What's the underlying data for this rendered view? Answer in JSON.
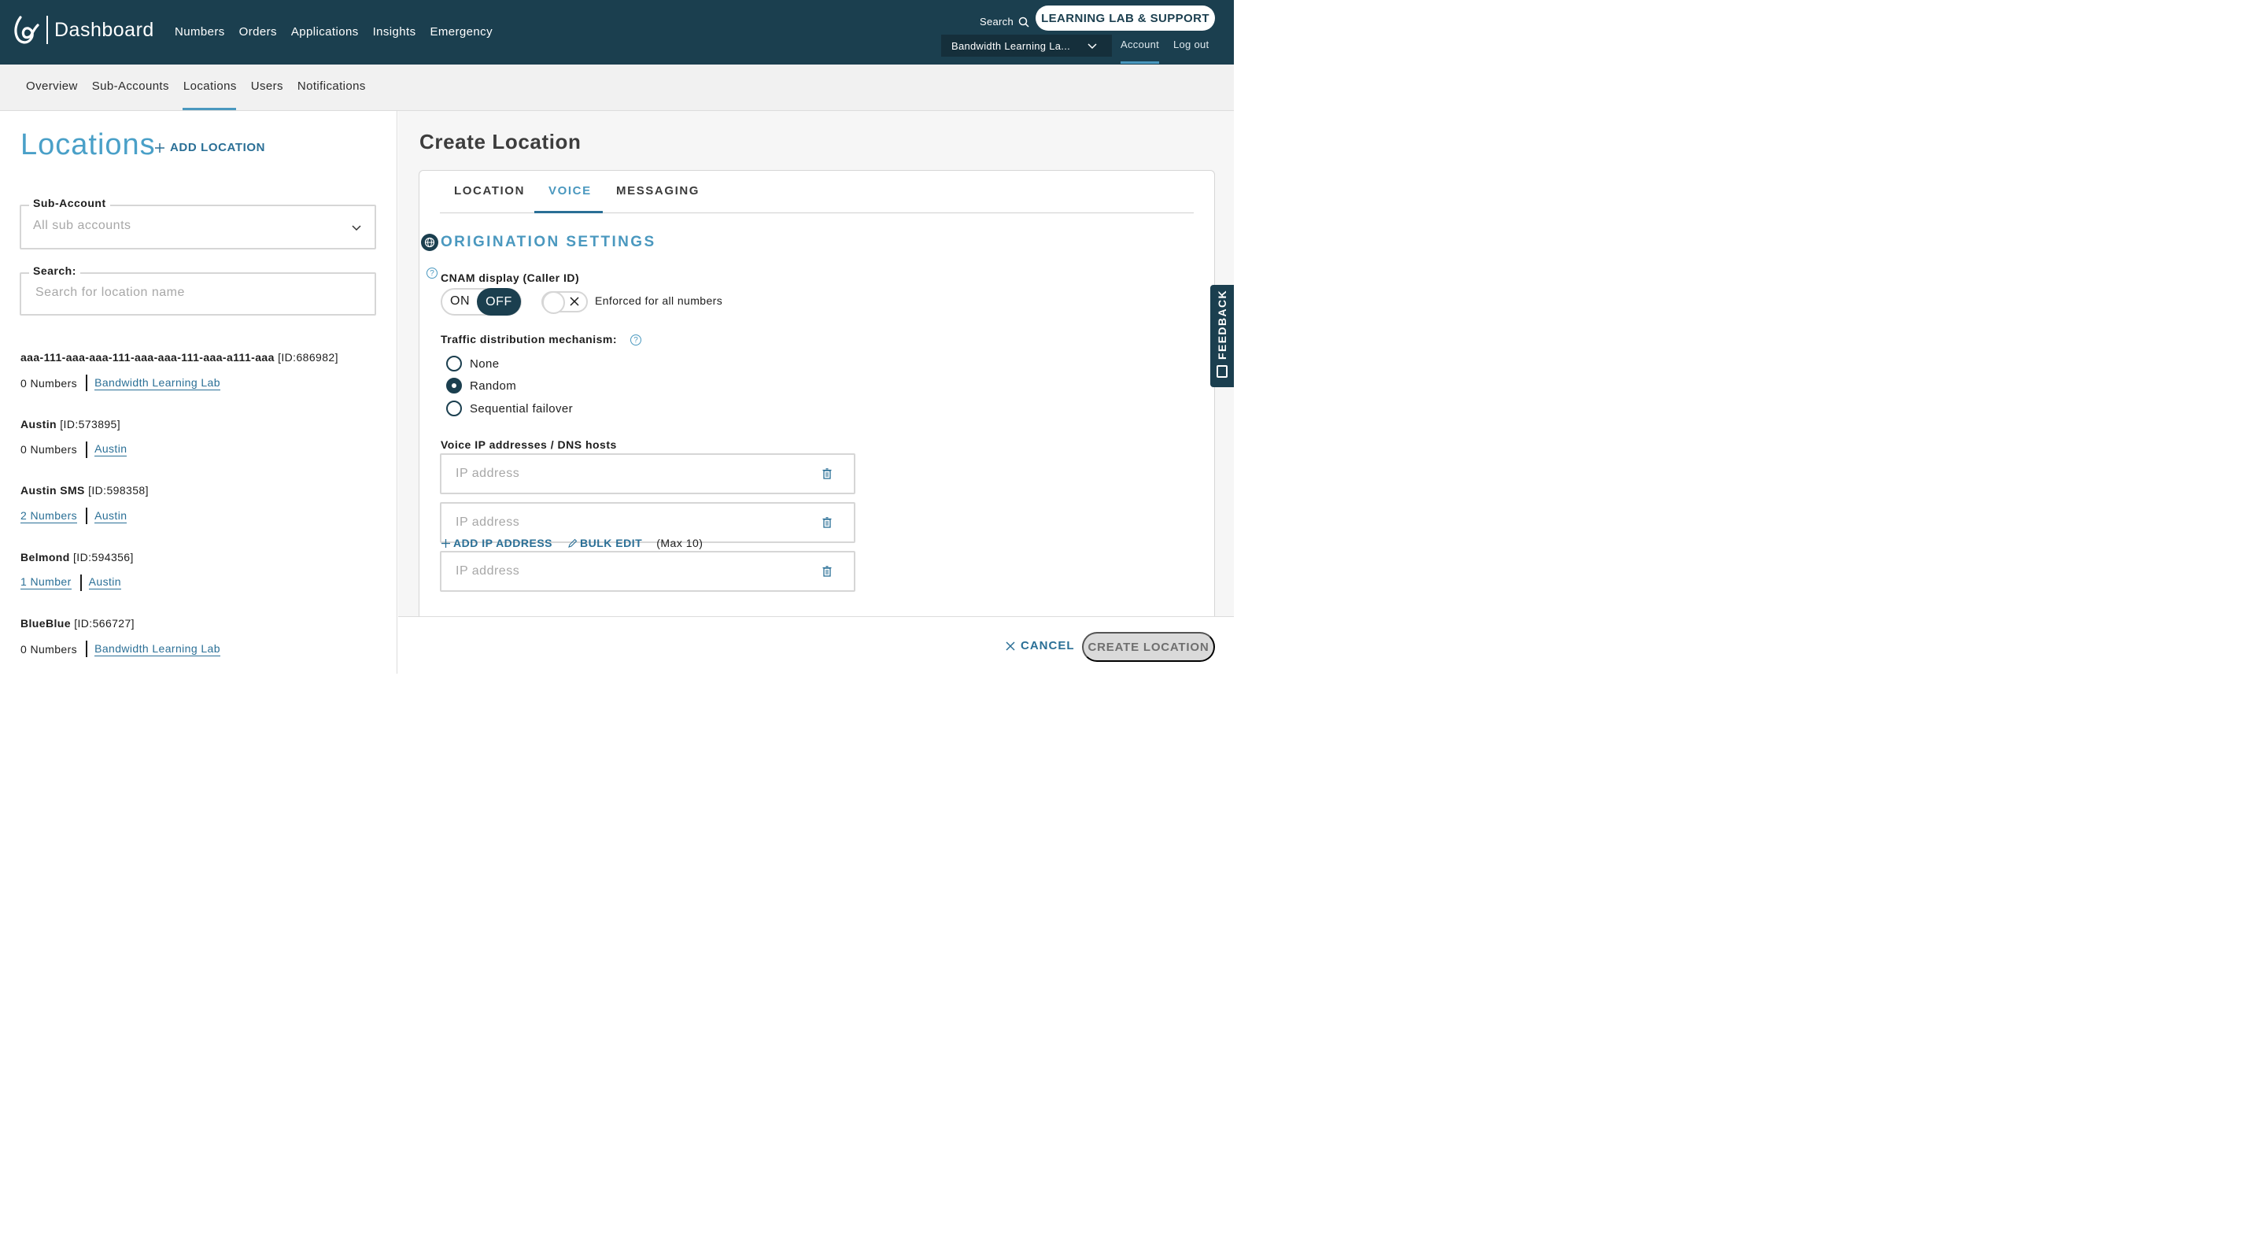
{
  "header": {
    "brand": "Dashboard",
    "nav": [
      "Numbers",
      "Orders",
      "Applications",
      "Insights",
      "Emergency"
    ],
    "search_label": "Search",
    "support_button": "LEARNING LAB & SUPPORT",
    "account_selector": "Bandwidth Learning La...",
    "account_link": "Account",
    "logout_link": "Log out",
    "colors": {
      "bar": "#1b3f4f",
      "accent": "#4a98bf"
    }
  },
  "subnav": {
    "items": [
      "Overview",
      "Sub-Accounts",
      "Locations",
      "Users",
      "Notifications"
    ],
    "active": "Locations"
  },
  "locations_panel": {
    "title": "Locations",
    "add_label": "ADD LOCATION",
    "subaccount": {
      "label": "Sub-Account",
      "value": "All sub accounts"
    },
    "search": {
      "label": "Search:",
      "placeholder": "Search for location name"
    },
    "items": [
      {
        "name": "aaa-111-aaa-aaa-111-aaa-aaa-111-aaa-a111-aaa",
        "id": "[ID:686982]",
        "numbers": "0 Numbers",
        "numbers_link": false,
        "subaccount": "Bandwidth Learning Lab"
      },
      {
        "name": "Austin",
        "id": "[ID:573895]",
        "numbers": "0 Numbers",
        "numbers_link": false,
        "subaccount": "Austin"
      },
      {
        "name": "Austin SMS",
        "id": "[ID:598358]",
        "numbers": "2 Numbers",
        "numbers_link": true,
        "subaccount": "Austin"
      },
      {
        "name": "Belmond",
        "id": "[ID:594356]",
        "numbers": "1 Number",
        "numbers_link": true,
        "subaccount": "Austin"
      },
      {
        "name": "BlueBlue",
        "id": "[ID:566727]",
        "numbers": "0 Numbers",
        "numbers_link": false,
        "subaccount": "Bandwidth Learning Lab"
      }
    ]
  },
  "create_location": {
    "title": "Create Location",
    "tabs": [
      "LOCATION",
      "VOICE",
      "MESSAGING"
    ],
    "active_tab": "VOICE",
    "section_title": "ORIGINATION SETTINGS",
    "cnam": {
      "label": "CNAM display (Caller ID)",
      "on_label": "ON",
      "off_label": "OFF",
      "state": "OFF",
      "enforced_label": "Enforced for all numbers",
      "enforced": false
    },
    "traffic": {
      "label": "Traffic distribution mechanism:",
      "options": [
        "None",
        "Random",
        "Sequential failover"
      ],
      "selected": "Random"
    },
    "voice_ip": {
      "label": "Voice IP addresses / DNS hosts",
      "placeholders": [
        "IP address",
        "IP address",
        "IP address"
      ],
      "add_label": "ADD IP ADDRESS",
      "bulk_label": "BULK EDIT",
      "max_note": "(Max 10)"
    },
    "cancel_label": "CANCEL",
    "create_label": "CREATE LOCATION"
  },
  "feedback_label": "FEEDBACK"
}
